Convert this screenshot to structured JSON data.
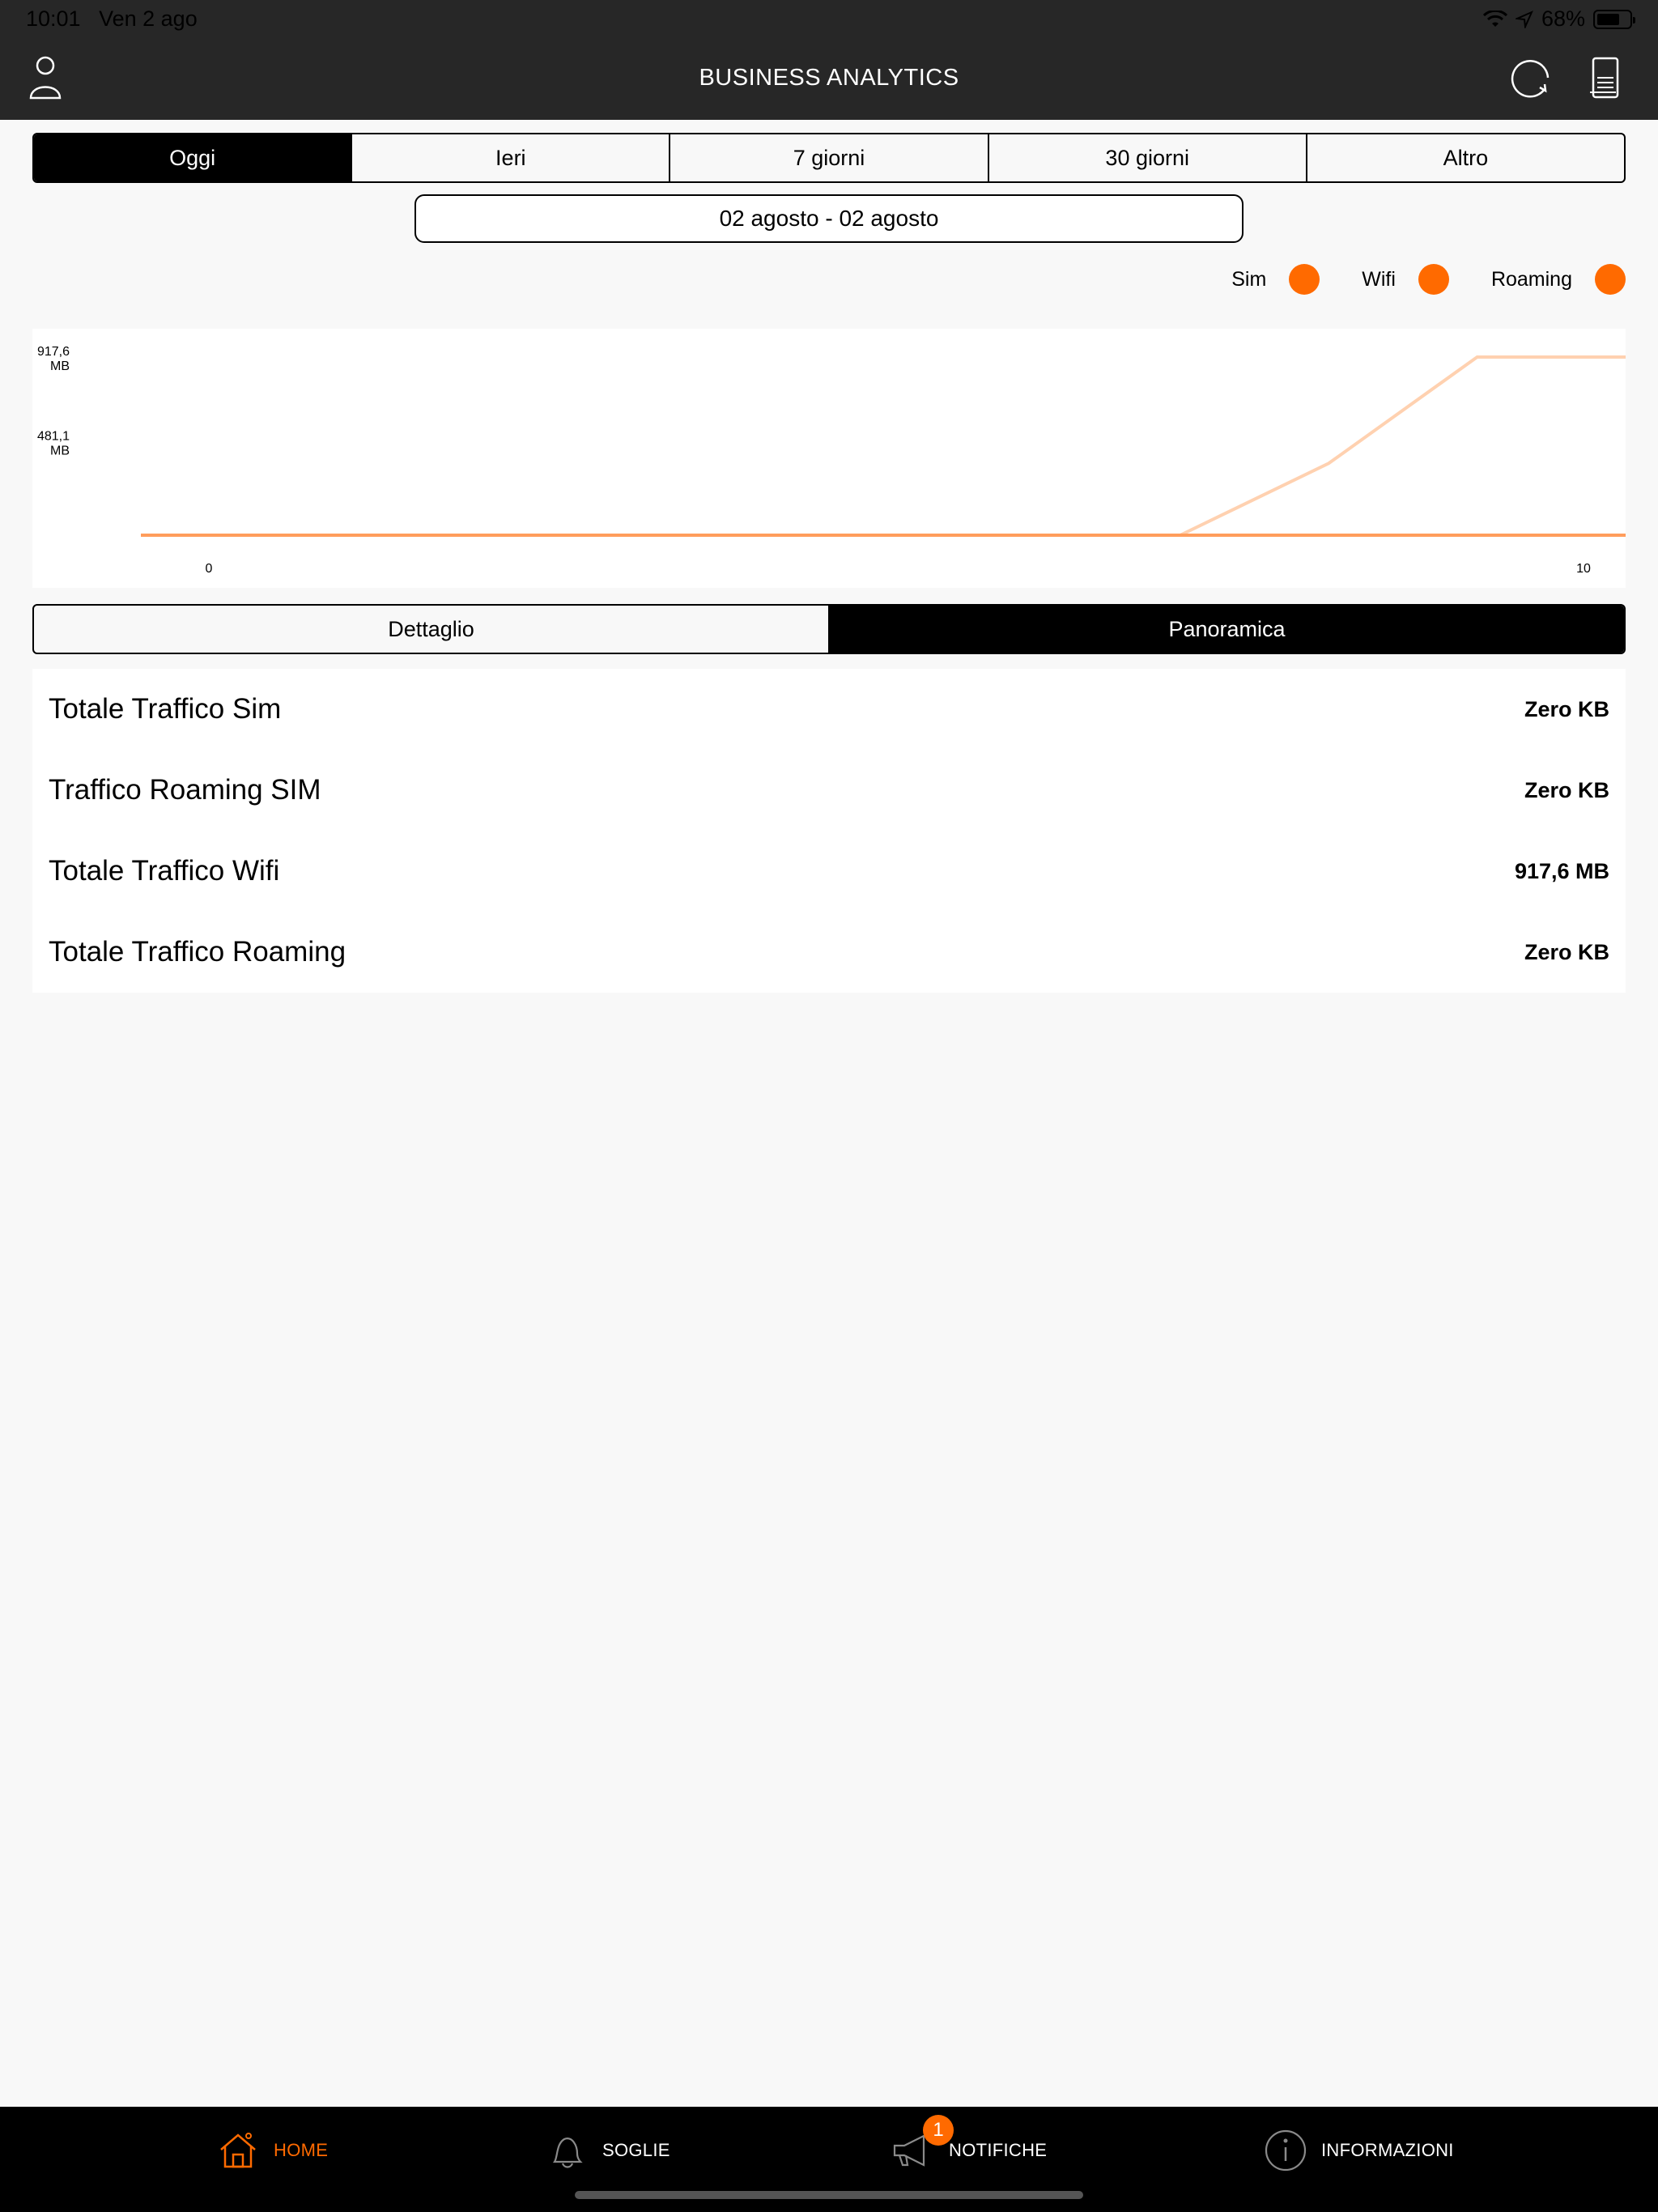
{
  "status_bar": {
    "time": "10:01",
    "date": "Ven 2 ago",
    "battery": "68%"
  },
  "nav": {
    "title": "BUSINESS  ANALYTICS",
    "left_icon": "user-icon",
    "right_icons": [
      "refresh-icon",
      "document-icon"
    ]
  },
  "period_tabs": [
    {
      "label": "Oggi",
      "active": true
    },
    {
      "label": "Ieri",
      "active": false
    },
    {
      "label": "7 giorni",
      "active": false
    },
    {
      "label": "30 giorni",
      "active": false
    },
    {
      "label": "Altro",
      "active": false
    }
  ],
  "date_range": "02 agosto - 02 agosto",
  "legend": [
    {
      "label": "Sim",
      "color": "#ff6a00"
    },
    {
      "label": "Wifi",
      "color": "#ff6a00"
    },
    {
      "label": "Roaming",
      "color": "#ff6a00"
    }
  ],
  "chart_data": {
    "type": "line",
    "x": [
      0,
      1,
      2,
      3,
      4,
      5,
      6,
      7,
      8,
      9,
      10
    ],
    "x_tick_labels": [
      "0",
      "10"
    ],
    "y_tick_labels": [
      {
        "line1": "917,6",
        "line2": "MB",
        "value": 917.6
      },
      {
        "line1": "481,1",
        "line2": "MB",
        "value": 481.1
      }
    ],
    "ylim": [
      0,
      917.6
    ],
    "series": [
      {
        "key": "wifi",
        "color": "#ffd1b0",
        "values": [
          0,
          0,
          0,
          0,
          0,
          0,
          0,
          0,
          370,
          917.6,
          917.6
        ]
      },
      {
        "key": "sim",
        "color": "#ff9d5c",
        "values": [
          0,
          0,
          0,
          0,
          0,
          0,
          0,
          0,
          0,
          0,
          0
        ]
      }
    ]
  },
  "view_tabs": [
    {
      "label": "Dettaglio",
      "active": false
    },
    {
      "label": "Panoramica",
      "active": true
    }
  ],
  "summary": [
    {
      "label": "Totale Traffico Sim",
      "value": "Zero KB"
    },
    {
      "label": "Traffico Roaming SIM",
      "value": "Zero KB"
    },
    {
      "label": "Totale Traffico Wifi",
      "value": "917,6 MB"
    },
    {
      "label": "Totale Traffico Roaming",
      "value": "Zero KB"
    }
  ],
  "tabbar": {
    "items": [
      {
        "label": "HOME",
        "icon": "home-icon",
        "active": true
      },
      {
        "label": "SOGLIE",
        "icon": "bell-icon",
        "active": false
      },
      {
        "label": "NOTIFICHE",
        "icon": "megaphone-icon",
        "active": false
      },
      {
        "label": "INFORMAZIONI",
        "icon": "info-icon",
        "active": false
      }
    ],
    "notifications_badge": "1"
  }
}
